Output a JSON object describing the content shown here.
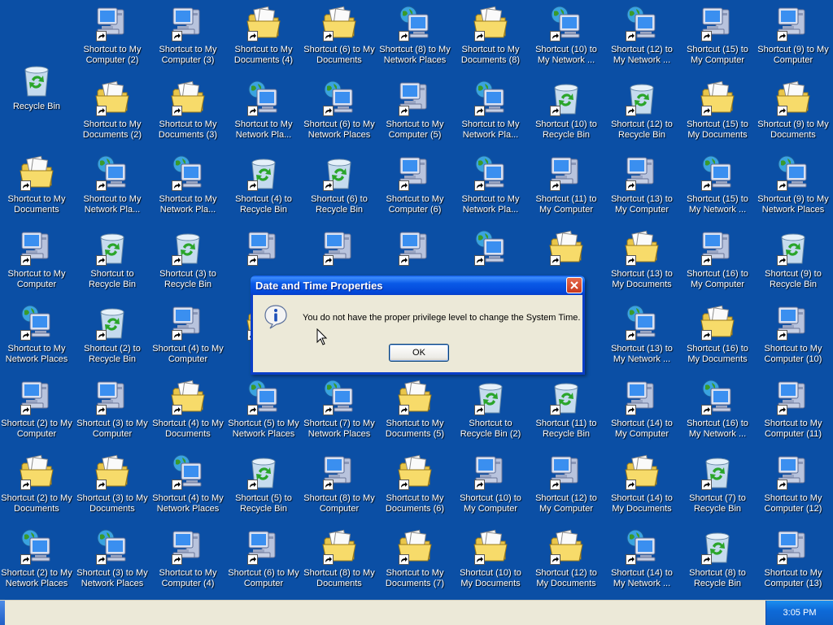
{
  "desktop": {
    "icons": [
      {
        "label": "Recycle Bin",
        "type": "recycle",
        "shortcut": false
      },
      {
        "label": "Shortcut to My\nComputer (2)",
        "type": "computer",
        "shortcut": true
      },
      {
        "label": "Shortcut to My\nComputer (3)",
        "type": "computer",
        "shortcut": true
      },
      {
        "label": "Shortcut to My\nDocuments (4)",
        "type": "documents",
        "shortcut": true
      },
      {
        "label": "Shortcut (6) to My\nDocuments",
        "type": "documents",
        "shortcut": true
      },
      {
        "label": "Shortcut (8) to My\nNetwork Places",
        "type": "network",
        "shortcut": true
      },
      {
        "label": "Shortcut to My\nDocuments (8)",
        "type": "documents",
        "shortcut": true
      },
      {
        "label": "Shortcut (10) to\nMy Network ...",
        "type": "network",
        "shortcut": true
      },
      {
        "label": "Shortcut (12) to\nMy Network ...",
        "type": "network",
        "shortcut": true
      },
      {
        "label": "Shortcut (15) to\nMy Computer",
        "type": "computer",
        "shortcut": true
      },
      {
        "label": "Shortcut (9) to My\nComputer",
        "type": "computer",
        "shortcut": true
      },
      {
        "label": "Shortcut to My\nDocuments (2)",
        "type": "documents",
        "shortcut": true
      },
      {
        "label": "Shortcut to My\nDocuments (3)",
        "type": "documents",
        "shortcut": true
      },
      {
        "label": "Shortcut to My\nNetwork Pla...",
        "type": "network",
        "shortcut": true
      },
      {
        "label": "Shortcut (6) to My\nNetwork Places",
        "type": "network",
        "shortcut": true
      },
      {
        "label": "Shortcut to My\nComputer (5)",
        "type": "computer",
        "shortcut": true
      },
      {
        "label": "Shortcut to My\nNetwork Pla...",
        "type": "network",
        "shortcut": true
      },
      {
        "label": "Shortcut (10) to\nRecycle Bin",
        "type": "recycle",
        "shortcut": true
      },
      {
        "label": "Shortcut (12) to\nRecycle Bin",
        "type": "recycle",
        "shortcut": true
      },
      {
        "label": "Shortcut (15) to\nMy Documents",
        "type": "documents",
        "shortcut": true
      },
      {
        "label": "Shortcut (9) to My\nDocuments",
        "type": "documents",
        "shortcut": true
      },
      {
        "label": "Shortcut to My\nDocuments",
        "type": "documents",
        "shortcut": true
      },
      {
        "label": "Shortcut to My\nNetwork Pla...",
        "type": "network",
        "shortcut": true
      },
      {
        "label": "Shortcut to My\nNetwork Pla...",
        "type": "network",
        "shortcut": true
      },
      {
        "label": "Shortcut (4) to\nRecycle Bin",
        "type": "recycle",
        "shortcut": true
      },
      {
        "label": "Shortcut (6) to\nRecycle Bin",
        "type": "recycle",
        "shortcut": true
      },
      {
        "label": "Shortcut to My\nComputer (6)",
        "type": "computer",
        "shortcut": true
      },
      {
        "label": "Shortcut to My\nNetwork Pla...",
        "type": "network",
        "shortcut": true
      },
      {
        "label": "Shortcut (11) to\nMy Computer",
        "type": "computer",
        "shortcut": true
      },
      {
        "label": "Shortcut (13) to\nMy Computer",
        "type": "computer",
        "shortcut": true
      },
      {
        "label": "Shortcut (15) to\nMy Network ...",
        "type": "network",
        "shortcut": true
      },
      {
        "label": "Shortcut (9) to My\nNetwork Places",
        "type": "network",
        "shortcut": true
      },
      {
        "label": "Shortcut to My\nComputer",
        "type": "computer",
        "shortcut": true
      },
      {
        "label": "Shortcut to\nRecycle Bin",
        "type": "recycle",
        "shortcut": true
      },
      {
        "label": "Shortcut (3) to\nRecycle Bin",
        "type": "recycle",
        "shortcut": true
      },
      {
        "label": "",
        "type": "computer",
        "shortcut": true
      },
      {
        "label": "",
        "type": "computer",
        "shortcut": true
      },
      {
        "label": "",
        "type": "computer",
        "shortcut": true
      },
      {
        "label": "",
        "type": "network",
        "shortcut": true
      },
      {
        "label": "",
        "type": "documents",
        "shortcut": true
      },
      {
        "label": "Shortcut (13) to\nMy Documents",
        "type": "documents",
        "shortcut": true
      },
      {
        "label": "Shortcut (16) to\nMy Computer",
        "type": "computer",
        "shortcut": true
      },
      {
        "label": "Shortcut (9) to\nRecycle Bin",
        "type": "recycle",
        "shortcut": true
      },
      {
        "label": "Shortcut to My\nNetwork Places",
        "type": "network",
        "shortcut": true
      },
      {
        "label": "Shortcut (2) to\nRecycle Bin",
        "type": "recycle",
        "shortcut": true
      },
      {
        "label": "Shortcut (4) to My\nComputer",
        "type": "computer",
        "shortcut": true
      },
      {
        "label": "",
        "type": "documents",
        "shortcut": true
      },
      {
        "label": "",
        "type": "computer",
        "shortcut": true
      },
      {
        "label": "",
        "type": "computer",
        "shortcut": true
      },
      {
        "label": "",
        "type": "network",
        "shortcut": true
      },
      {
        "label": "",
        "type": "network",
        "shortcut": true
      },
      {
        "label": "Shortcut (13) to\nMy Network ...",
        "type": "network",
        "shortcut": true
      },
      {
        "label": "Shortcut (16) to\nMy Documents",
        "type": "documents",
        "shortcut": true
      },
      {
        "label": "Shortcut to My\nComputer (10)",
        "type": "computer",
        "shortcut": true
      },
      {
        "label": "Shortcut (2) to My\nComputer",
        "type": "computer",
        "shortcut": true
      },
      {
        "label": "Shortcut (3) to My\nComputer",
        "type": "computer",
        "shortcut": true
      },
      {
        "label": "Shortcut (4) to My\nDocuments",
        "type": "documents",
        "shortcut": true
      },
      {
        "label": "Shortcut (5) to My\nNetwork Places",
        "type": "network",
        "shortcut": true
      },
      {
        "label": "Shortcut (7) to My\nNetwork Places",
        "type": "network",
        "shortcut": true
      },
      {
        "label": "Shortcut to My\nDocuments (5)",
        "type": "documents",
        "shortcut": true
      },
      {
        "label": "Shortcut to\nRecycle Bin (2)",
        "type": "recycle",
        "shortcut": true
      },
      {
        "label": "Shortcut (11) to\nRecycle Bin",
        "type": "recycle",
        "shortcut": true
      },
      {
        "label": "Shortcut (14) to\nMy Computer",
        "type": "computer",
        "shortcut": true
      },
      {
        "label": "Shortcut (16) to\nMy Network ...",
        "type": "network",
        "shortcut": true
      },
      {
        "label": "Shortcut to My\nComputer (11)",
        "type": "computer",
        "shortcut": true
      },
      {
        "label": "Shortcut (2) to My\nDocuments",
        "type": "documents",
        "shortcut": true
      },
      {
        "label": "Shortcut (3) to My\nDocuments",
        "type": "documents",
        "shortcut": true
      },
      {
        "label": "Shortcut (4) to My\nNetwork Places",
        "type": "network",
        "shortcut": true
      },
      {
        "label": "Shortcut (5) to\nRecycle Bin",
        "type": "recycle",
        "shortcut": true
      },
      {
        "label": "Shortcut (8) to My\nComputer",
        "type": "computer",
        "shortcut": true
      },
      {
        "label": "Shortcut to My\nDocuments (6)",
        "type": "documents",
        "shortcut": true
      },
      {
        "label": "Shortcut (10) to\nMy Computer",
        "type": "computer",
        "shortcut": true
      },
      {
        "label": "Shortcut (12) to\nMy Computer",
        "type": "computer",
        "shortcut": true
      },
      {
        "label": "Shortcut (14) to\nMy Documents",
        "type": "documents",
        "shortcut": true
      },
      {
        "label": "Shortcut (7) to\nRecycle Bin",
        "type": "recycle",
        "shortcut": true
      },
      {
        "label": "Shortcut to My\nComputer (12)",
        "type": "computer",
        "shortcut": true
      },
      {
        "label": "Shortcut (2) to My\nNetwork Places",
        "type": "network",
        "shortcut": true
      },
      {
        "label": "Shortcut (3) to My\nNetwork Places",
        "type": "network",
        "shortcut": true
      },
      {
        "label": "Shortcut to My\nComputer (4)",
        "type": "computer",
        "shortcut": true
      },
      {
        "label": "Shortcut (6) to My\nComputer",
        "type": "computer",
        "shortcut": true
      },
      {
        "label": "Shortcut (8) to My\nDocuments",
        "type": "documents",
        "shortcut": true
      },
      {
        "label": "Shortcut to My\nDocuments (7)",
        "type": "documents",
        "shortcut": true
      },
      {
        "label": "Shortcut (10) to\nMy Documents",
        "type": "documents",
        "shortcut": true
      },
      {
        "label": "Shortcut (12) to\nMy Documents",
        "type": "documents",
        "shortcut": true
      },
      {
        "label": "Shortcut (14) to\nMy Network ...",
        "type": "network",
        "shortcut": true
      },
      {
        "label": "Shortcut (8) to\nRecycle Bin",
        "type": "recycle",
        "shortcut": true
      },
      {
        "label": "Shortcut to My\nComputer (13)",
        "type": "computer",
        "shortcut": true
      }
    ]
  },
  "dialog": {
    "title": "Date and Time Properties",
    "message": "You do not have the proper privilege level to change the System Time.",
    "ok_label": "OK",
    "icon": "info-icon"
  },
  "taskbar": {
    "clock": "3:05 PM"
  },
  "colors": {
    "desktop": "#0b4fa5",
    "titlebar": "#0a58e6",
    "dialog_body": "#ece9d8"
  }
}
